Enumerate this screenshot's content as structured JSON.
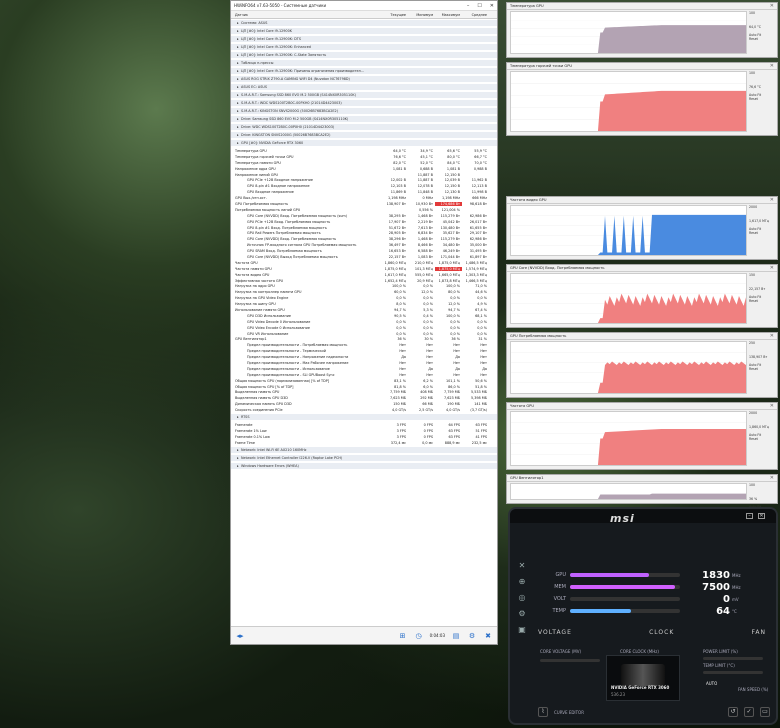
{
  "hwinfo": {
    "title": "HWiNFO64 v7.63-5050 - Системные датчики",
    "headers": [
      "Датчик",
      "Текущее",
      "Минимум",
      "Максимум",
      "Среднее"
    ],
    "sections": [
      "Система: ASUS",
      "ЦП [#0]: Intel Core i9-12900K",
      "ЦП [#0]: Intel Core i9-12900K: DTS",
      "ЦП [#0]: Intel Core i9-12900K: Enhanced",
      "ЦП [#0]: Intel Core i9-12900K: C-State Занятость",
      "Таблица п-прессы",
      "ЦП [#0]: Intel Core i9-12900K: Причины ограничения производител...",
      "ASUS ROG STRIX Z790-A GAMING WIFI D4 (Nuvoton NCT6798D)",
      "ASUS EC: ASUS",
      "S.M.A.R.T.: Samsung SSD 860 EVO M.2 500GB (S414NX0R305110K)",
      "S.M.A.R.T.: WDC WDS100T2B0C-00PXH0 (21014D4423003)",
      "S.M.A.R.T.: KINGSTON SNVS2000G (50026B7683BCA2E2)",
      "Drive: Samsung SSD 860 EVO M.2 500GB (S414NX0R305110K)",
      "Drive: WDC WDS100T2B0C-00PXH0 (21014D4423003)",
      "Drive: KINGSTON SNVS2000G (50026B7683BCA2E2)"
    ],
    "gpu_section": "GPU [#0]: NVIDIA GeForce RTX 3060",
    "gpu_rows": [
      [
        "Температура GPU",
        "64,0 °C",
        "34,9 °C",
        "65,6 °C",
        "55,9 °C"
      ],
      [
        "Температура горячей точки GPU",
        "76,6 °C",
        "45,1 °C",
        "80,0 °C",
        "66,7 °C"
      ],
      [
        "Температура памяти GPU",
        "82,0 °C",
        "52,0 °C",
        "84,0 °C",
        "70,0 °C"
      ],
      [
        "Напряжение ядра GPU",
        "1,081 В",
        "0,688 В",
        "1,081 В",
        "0,988 В"
      ],
      [
        "Напряжение линий GPU",
        "",
        "11,887 В",
        "12,150 В",
        ""
      ],
      [
        "GPU PCIe +12В Входное напряжение",
        "12,002 В",
        "11,887 В",
        "12,039 В",
        "11,962 В"
      ],
      [
        "GPU 8-pin #1 Входное напряжение",
        "12,103 В",
        "12,078 В",
        "12,150 В",
        "12,113 В"
      ],
      [
        "GPU Входное напряжение",
        "11,869 В",
        "11,848 В",
        "12,130 В",
        "11,998 В"
      ],
      [
        "GPU Вых./отн.ост.",
        "1,198 MHz",
        "0 MHz",
        "1,198 MHz",
        "666 MHz"
      ],
      [
        "GPU Потребляемая мощность",
        "138,907 Вт",
        "10,930 Вт",
        "174,686 Вт",
        "98,618 Вт"
      ],
      [
        "Потребляемая мощность линий GPU",
        "",
        "0,556 %",
        "121,004 %",
        ""
      ],
      [
        "GPU Core (NVVDD) Вход. Потребляемая мощность (sum)",
        "38,295 Вт",
        "1,468 Вт",
        "115,279 Вт",
        "62,986 Вт"
      ],
      [
        "GPU PCIe +12В Вход. Потребляемая мощность",
        "17,907 Вт",
        "2,219 Вт",
        "45,042 Вт",
        "26,017 Вт"
      ],
      [
        "GPU 8-pin #1 Вход. Потребляемая мощность",
        "51,672 Вт",
        "7,613 Вт",
        "130,480 Вт",
        "61,655 Вт"
      ],
      [
        "GPU Rail Powers Потребляемая мощность",
        "28,905 Вт",
        "6,834 Вт",
        "35,627 Вт",
        "29,107 Вт"
      ],
      [
        "GPU Core (NVVDD) Вход. Потребляемая мощность",
        "38,296 Вт",
        "1,468 Вт",
        "115,279 Вт",
        "62,986 Вт"
      ],
      [
        "Источник FP-входного сигнала GPU Потребляемая мощность",
        "36,497 Вт",
        "8,466 Вт",
        "34,480 Вт",
        "35,000 Вт"
      ],
      [
        "GPU SRAM Вход. Потребляемая мощность",
        "16,653 Вт",
        "6,588 Вт",
        "46,249 Вт",
        "31,495 Вт"
      ],
      [
        "GPU Core (NVVDD) Выход Потребляемая мощность",
        "22,157 Вт",
        "1,083 Вт",
        "171,044 Вт",
        "61,897 Вт"
      ],
      [
        "Частота GPU",
        "1,860,0 МГц",
        "210,0 МГц",
        "1,875,0 МГц",
        "1,486,5 МГц"
      ],
      [
        "Частота памяти GPU",
        "1,875,0 МГц",
        "101,3 МГц",
        "1,875,0 МГц",
        "1,574,9 МГц"
      ],
      [
        "Частота видео GPU",
        "1,617,0 МГц",
        "555,0 МГц",
        "1,665,0 МГц",
        "1,303,3 МГц"
      ],
      [
        "Эффективная частота GPU",
        "1,652,4 МГц",
        "20,9 МГц",
        "1,873,8 МГц",
        "1,466,5 МГц"
      ],
      [
        "Нагрузка на ядро GPU",
        "100,0 %",
        "0,0 %",
        "100,0 %",
        "71,0 %"
      ],
      [
        "Нагрузка на контроллер памяти GPU",
        "60,0 %",
        "12,0 %",
        "80,0 %",
        "44,6 %"
      ],
      [
        "Нагрузка на GPU Video Engine",
        "0,0 %",
        "0,0 %",
        "0,0 %",
        "0,0 %"
      ],
      [
        "Нагрузка на шину GPU",
        "8,0 %",
        "0,0 %",
        "12,0 %",
        "4,9 %"
      ],
      [
        "Использование памяти GPU",
        "94,7 %",
        "5,3 %",
        "94,7 %",
        "67,4 %"
      ],
      [
        "GPU D3D Использование",
        "90,5 %",
        "0,4 %",
        "100,0 %",
        "68,1 %"
      ],
      [
        "GPU Video Decode 0 Использование",
        "0,0 %",
        "0,0 %",
        "0,0 %",
        "0,0 %"
      ],
      [
        "GPU Video Encode 0 Использование",
        "0,0 %",
        "0,0 %",
        "0,0 %",
        "0,0 %"
      ],
      [
        "GPU VR Использование",
        "0,0 %",
        "0,0 %",
        "0,0 %",
        "0,0 %"
      ],
      [
        "GPU Вентилятор1",
        "36 %",
        "30 %",
        "36 %",
        "31 %"
      ],
      [
        "Предел производительности - Потребляемая мощность",
        "Нет",
        "Нет",
        "Нет",
        "Нет"
      ],
      [
        "Предел производительности - Термический",
        "Нет",
        "Нет",
        "Нет",
        "Нет"
      ],
      [
        "Предел производительности - Напряжение надежности",
        "Да",
        "Нет",
        "Да",
        "Нет"
      ],
      [
        "Предел производительности - Max Рабочее напряжение",
        "Нет",
        "Нет",
        "Нет",
        "Нет"
      ],
      [
        "Предел производительности - Использование",
        "Нет",
        "Да",
        "Да",
        "Да"
      ],
      [
        "Предел производительности - SLI GPUBoost Sync",
        "Нет",
        "Нет",
        "Нет",
        "Нет"
      ],
      [
        "Общая мощность GPU (нормализованная) [% of TDP]",
        "83,1 %",
        "6,2 %",
        "101,1 %",
        "50,6 %"
      ],
      [
        "Общая мощность GPU [% of TDP]",
        "81,8 %",
        "6,0 %",
        "86,0 %",
        "51,8 %"
      ],
      [
        "Выделенная память GPU",
        "7,759 МБ",
        "408 МБ",
        "7,759 МБ",
        "5,533 МБ"
      ],
      [
        "Выделенная память GPU D3D",
        "7,623 МБ",
        "292 МБ",
        "7,623 МБ",
        "5,398 МБ"
      ],
      [
        "Динамическая память GPU D3D",
        "150 МБ",
        "66 МБ",
        "190 МБ",
        "141 МБ"
      ],
      [
        "Скорость соединения PCIe",
        "4,0 GT/s",
        "2,5 GT/s",
        "4,0 GT/s",
        "(3,7 GT/s)"
      ]
    ],
    "rtss_section": "RTSS",
    "rtss_rows": [
      [
        "Framerate",
        "3 FPS",
        "0 FPS",
        "64 FPS",
        "63 FPS"
      ],
      [
        "Framerate 1% Low",
        "3 FPS",
        "0 FPS",
        "63 FPS",
        "51 FPS"
      ],
      [
        "Framerate 0.1% Low",
        "3 FPS",
        "0 FPS",
        "63 FPS",
        "41 FPS"
      ],
      [
        "Frame Time",
        "372,4 мс",
        "0,0 мс",
        "888,9 мс",
        "232,5 мс"
      ]
    ],
    "tail_sections": [
      "Network: Intel Wi-Fi 6E AX210 160MHz",
      "Network: Intel Ethernet Controller I226-V (Raptor Lake PCH)",
      "Windows Hardware Errors (WHEA)"
    ],
    "footer_time": "0:04:03"
  },
  "graphs": [
    {
      "title": "Температура GPU",
      "max": "100",
      "cur": "64,0 °C",
      "color": "#b3a3b3",
      "kind": "step_up_high"
    },
    {
      "title": "Температура горячей точки GPU",
      "max": "100",
      "cur": "76,6 °C",
      "color": "#f08080",
      "kind": "step_up_high"
    },
    {
      "title": "Частота видео GPU",
      "max": "2000",
      "cur": "1,617,0 МГц",
      "color": "#4a8be0",
      "kind": "spikes_then_full"
    },
    {
      "title": "GPU Core (NVVDD) Вход. Потребляемая мощность",
      "max": "150",
      "cur": "22,157 Вт",
      "color": "#f08080",
      "kind": "noisy_high"
    },
    {
      "title": "GPU Потребляемая мощность",
      "max": "250",
      "cur": "138,907 Вт",
      "color": "#f08080",
      "kind": "step_mid"
    },
    {
      "title": "Частота GPU",
      "max": "2000",
      "cur": "1,860,0 МГц",
      "color": "#f08080",
      "kind": "step_up_high"
    },
    {
      "title": "GPU Вентилятор1",
      "max": "100",
      "cur": "36 %",
      "color": "#b3a3b3",
      "kind": "step_low"
    }
  ],
  "graph_side": {
    "auto": "Auto Fit",
    "reset": "Reset"
  },
  "msi": {
    "logo": "msi",
    "bars": [
      {
        "label": "GPU",
        "value": "1830",
        "unit": "MHz",
        "pct": 0.72,
        "color": "#c061ff"
      },
      {
        "label": "MEM",
        "value": "7500",
        "unit": "MHz",
        "pct": 0.95,
        "color": "#d060ff"
      },
      {
        "label": "VOLT",
        "value": "0",
        "unit": "mV",
        "pct": 0.0,
        "color": "#5fb0ff"
      },
      {
        "label": "TEMP",
        "value": "64",
        "unit": "°C",
        "pct": 0.55,
        "color": "#5fb0ff"
      }
    ],
    "tabs": [
      "VOLTAGE",
      "CLOCK",
      "FAN"
    ],
    "core_voltage": "CORE VOLTAGE (MV)",
    "core_clock": "CORE CLOCK (MHz)",
    "memory_clock": "MEMORY CLOCK (MHz)",
    "power_limit": "POWER LIMIT (%)",
    "temp_limit": "TEMP LIMIT (°C)",
    "fan_speed": "FAN SPEED (%)",
    "card_name": "NVIDIA GeForce RTX 3060",
    "card_ver": "536.23",
    "curve_editor": "CURVE EDITOR",
    "auto": "AUTO"
  }
}
